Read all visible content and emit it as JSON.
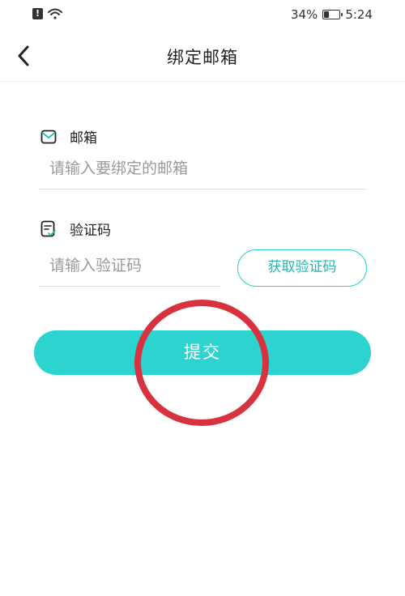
{
  "status_bar": {
    "battery_percent": "34%",
    "battery_level": 0.34,
    "time": "5:24",
    "icons": [
      "alert-icon",
      "wifi-icon",
      "battery-icon"
    ]
  },
  "header": {
    "title": "绑定邮箱",
    "back_icon": "chevron-left-icon"
  },
  "form": {
    "email": {
      "label": "邮箱",
      "icon": "mail-icon",
      "placeholder": "请输入要绑定的邮箱",
      "value": ""
    },
    "code": {
      "label": "验证码",
      "icon": "verify-doc-icon",
      "placeholder": "请输入验证码",
      "value": "",
      "get_code_label": "获取验证码"
    },
    "submit_label": "提交"
  },
  "colors": {
    "accent": "#2dd4cf",
    "annotation": "#d8323f"
  }
}
